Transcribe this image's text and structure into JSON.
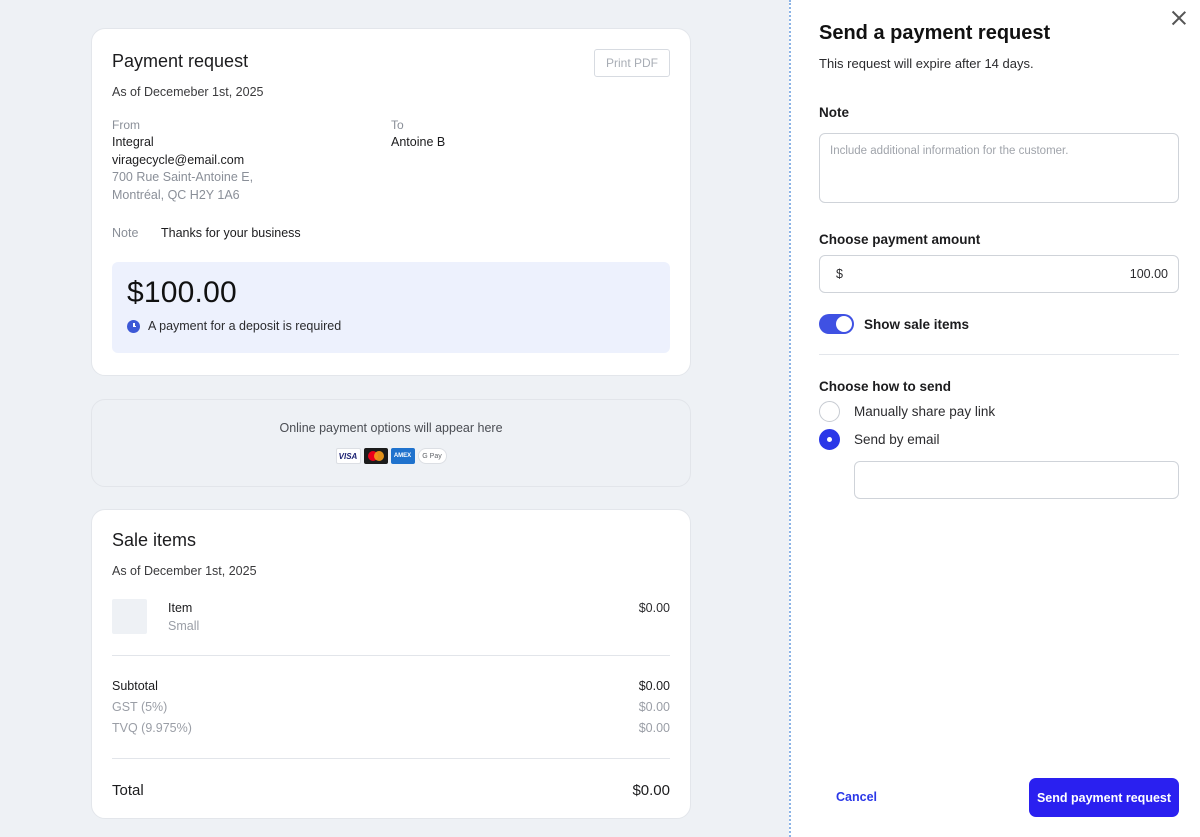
{
  "preview": {
    "request": {
      "title": "Payment request",
      "as_of": "As of Decemeber 1st, 2025",
      "print_label": "Print PDF",
      "from_label": "From",
      "from_name": "Integral",
      "from_email": "viragecycle@email.com",
      "from_address_1": "700 Rue Saint-Antoine E,",
      "from_address_2": "Montréal, QC  H2Y 1A6",
      "to_label": "To",
      "to_name": "Antoine B",
      "note_label": "Note",
      "note_value": "Thanks for your business",
      "amount": "$100.00",
      "deposit_text": "A payment for a deposit is required"
    },
    "online": {
      "text": "Online payment options will appear here",
      "icons": {
        "visa": "VISA",
        "mastercard": "mastercard-icon",
        "amex": "AMEX",
        "gpay": "G Pay"
      }
    },
    "items": {
      "title": "Sale items",
      "as_of": "As of December 1st, 2025",
      "list": [
        {
          "name": "Item",
          "variant": "Small",
          "price": "$0.00"
        }
      ],
      "subtotal_label": "Subtotal",
      "subtotal_value": "$0.00",
      "gst_label": "GST (5%)",
      "gst_value": "$0.00",
      "tvq_label": "TVQ (9.975%)",
      "tvq_value": "$0.00",
      "total_label": "Total",
      "total_value": "$0.00"
    }
  },
  "panel": {
    "title": "Send a payment request",
    "subtitle": "This request will expire after 14 days.",
    "note_label": "Note",
    "note_placeholder": "Include additional information for the customer.",
    "amount_label": "Choose payment amount",
    "currency": "$",
    "amount_value": "100.00",
    "toggle_label": "Show sale items",
    "toggle_on": true,
    "send_label": "Choose how to send",
    "options": [
      {
        "label": "Manually share pay link",
        "checked": false
      },
      {
        "label": "Send by email",
        "checked": true
      }
    ],
    "email_value": "",
    "cancel_label": "Cancel",
    "submit_label": "Send payment request"
  },
  "colors": {
    "accent": "#2a37e8",
    "amount_box": "#edf1fd",
    "background": "#eef1f5"
  }
}
